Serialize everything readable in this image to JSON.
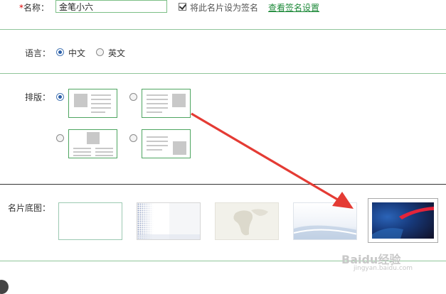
{
  "name": {
    "label": "名称：",
    "required_mark": "*",
    "value": "金笔小六"
  },
  "signature": {
    "checkbox_label": "将此名片设为签名",
    "checked": true,
    "link": "查看签名设置"
  },
  "language": {
    "label": "语言：",
    "options": [
      "中文",
      "英文"
    ],
    "selected": "中文"
  },
  "layout": {
    "label": "排版：",
    "selected_index": 0
  },
  "background": {
    "label": "名片底图："
  },
  "watermark": {
    "text": "Baidu经验",
    "sub": "jingyan.baidu.com"
  },
  "colors": {
    "accent_green": "#1e8a3a",
    "border_green": "#4ea560",
    "annotation_arrow": "#e43b34"
  }
}
